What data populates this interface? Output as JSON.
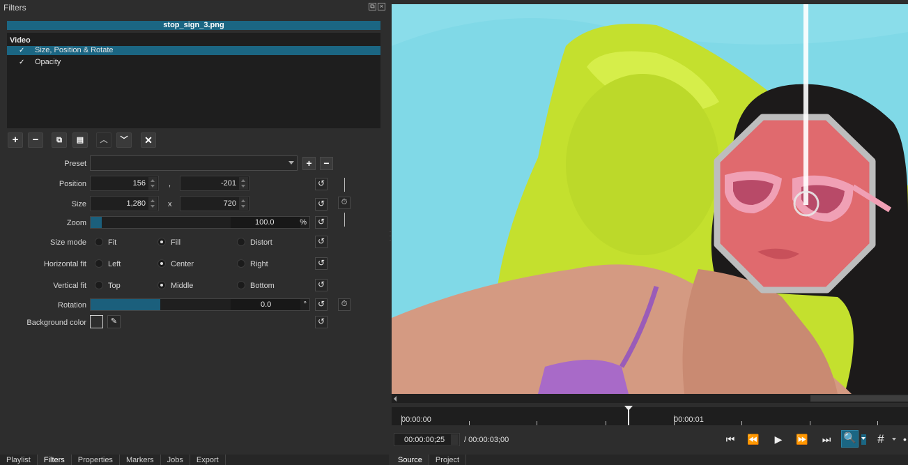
{
  "filters_panel": {
    "title": "Filters",
    "clip_name": "stop_sign_3.png",
    "group_label": "Video",
    "filters": [
      {
        "label": "Size, Position & Rotate",
        "checked": "✓",
        "selected": true
      },
      {
        "label": "Opacity",
        "checked": "✓",
        "selected": false
      }
    ],
    "toolbar": {
      "add_icon": "plus-icon",
      "remove_icon": "minus-icon",
      "copy_icon": "copy-icon",
      "paste_icon": "paste-icon",
      "up_icon": "chevron-up-icon",
      "down_icon": "chevron-down-icon",
      "deselect_icon": "close-icon"
    }
  },
  "properties": {
    "preset_label": "Preset",
    "preset_value": "",
    "position_label": "Position",
    "position_x": "156",
    "position_sep": ",",
    "position_y": "-201",
    "size_label": "Size",
    "size_w": "1,280",
    "size_sep": "x",
    "size_h": "720",
    "zoom_label": "Zoom",
    "zoom_value": "100.0",
    "zoom_unit": "%",
    "zoom_fraction": 0.05,
    "size_mode_label": "Size mode",
    "size_mode_options": [
      "Fit",
      "Fill",
      "Distort"
    ],
    "size_mode_selected": "Fill",
    "hfit_label": "Horizontal fit",
    "hfit_options": [
      "Left",
      "Center",
      "Right"
    ],
    "hfit_selected": "Center",
    "vfit_label": "Vertical fit",
    "vfit_options": [
      "Top",
      "Middle",
      "Bottom"
    ],
    "vfit_selected": "Middle",
    "rotation_label": "Rotation",
    "rotation_value": "0.0",
    "rotation_unit": "°",
    "rotation_fraction": 0.5,
    "background_color_label": "Background color",
    "background_color": "#2e2e2e"
  },
  "left_tabs": [
    "Playlist",
    "Filters",
    "Properties",
    "Markers",
    "Jobs",
    "Export"
  ],
  "left_active_tab": "Filters",
  "right_tabs": [
    "Source",
    "Project"
  ],
  "right_active_tab": "Source",
  "player": {
    "ruler_start": "00:00:00",
    "ruler_mid": "00:00:01",
    "current_time": "00:00:00;25",
    "total_time": "/ 00:00:03;00",
    "playhead_fraction": 0.457,
    "transport": {
      "skip_start_icon": "skip-previous-icon",
      "rewind_icon": "rewind-icon",
      "play_icon": "play-icon",
      "forward_icon": "fast-forward-icon",
      "skip_end_icon": "skip-next-icon",
      "zoom_icon": "zoom-in-icon",
      "grid_icon": "grid-icon"
    }
  },
  "colors": {
    "accent": "#1b6683",
    "panel_bg": "#2d2d2d",
    "list_bg": "#1e1e1e",
    "stop_sign": "#e06a6e",
    "float": "#c8e332",
    "water": "#7fd8e6"
  }
}
